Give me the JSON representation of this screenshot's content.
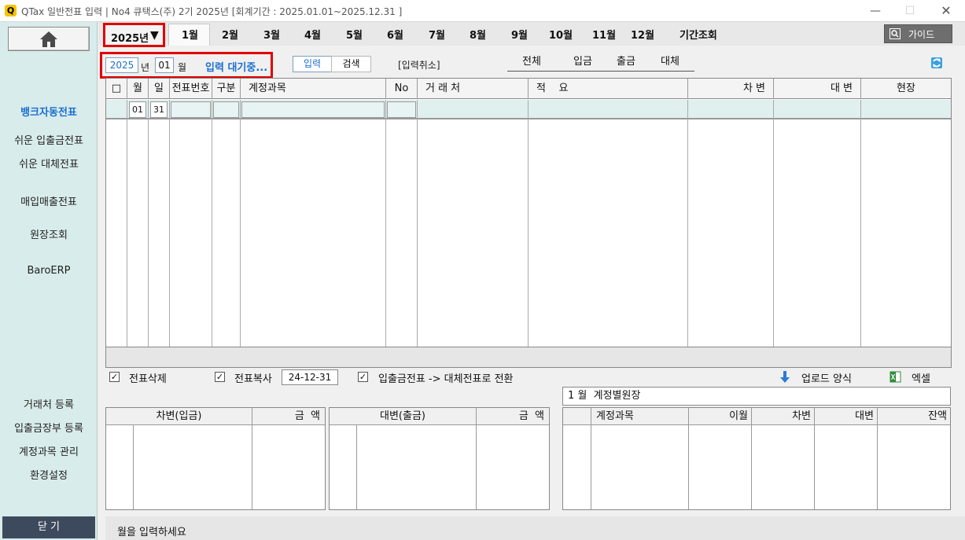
{
  "window": {
    "app_icon_letter": "Q",
    "title": "QTax 일반전표 입력 | No4 큐택스(주) 2기 2025년 [회계기간 : 2025.01.01~2025.12.31 ]",
    "minimize": "—",
    "maximize": "☐",
    "close": "✕"
  },
  "sidebar": {
    "home_icon": "home-icon",
    "items": [
      "뱅크자동전표",
      "쉬운 입출금전표",
      "쉬운 대체전표",
      "매입매출전표",
      "원장조회",
      "BaroERP",
      "거래처 등록",
      "입출금장부 등록",
      "계정과목 관리",
      "환경설정"
    ],
    "close_label": "닫 기"
  },
  "topbar": {
    "year_selector": "2025년",
    "year_arrow": "▼",
    "months": [
      "1월",
      "2월",
      "3월",
      "4월",
      "5월",
      "6월",
      "7월",
      "8월",
      "9월",
      "10월",
      "11월",
      "12월"
    ],
    "period_query": "기간조회",
    "guide_label": "가이드",
    "guide_icon": "search-icon"
  },
  "entry": {
    "year_value": "2025",
    "year_unit": "년",
    "month_value": "01",
    "month_unit": "월",
    "status_text": "입력 대기중...",
    "mode_input": "입력",
    "mode_search": "검색",
    "cancel_input": "[입력취소]",
    "filters": [
      "전체",
      "입금",
      "출금",
      "대체"
    ],
    "refresh_icon": "refresh-icon"
  },
  "grid": {
    "columns": [
      "□",
      "월",
      "일",
      "전표번호",
      "구분",
      "계정과목",
      "No",
      "거 래 처",
      "적    요",
      "차 변",
      "대 변",
      "현장"
    ],
    "first_row": {
      "month": "01",
      "day": "31"
    }
  },
  "options": {
    "delete_voucher": "전표삭제",
    "copy_voucher": "전표복사",
    "copy_date": "24-12-31",
    "convert": "입출금전표 -> 대체전표로 전환",
    "check_mark": "✓",
    "upload_label": "업로드 양식",
    "upload_icon": "download-arrow-icon",
    "excel_label": "엑셀",
    "excel_icon": "excel-icon"
  },
  "debit_panel": {
    "col1": "차변(입금)",
    "col2": "금  액"
  },
  "credit_panel": {
    "col1": "대변(출금)",
    "col2": "금  액"
  },
  "ledger_panel": {
    "title": "1 월  계정별원장",
    "columns": [
      "계정과목",
      "이월",
      "차변",
      "대변",
      "잔액"
    ]
  },
  "status_bar": {
    "message": "월을 입력하세요"
  },
  "colors": {
    "accent_blue": "#1b6fd1",
    "highlight_red": "#e00000",
    "sidebar_bg": "#d8eceb",
    "row_highlight": "#dff0ef",
    "close_bg": "#3d4a5e"
  }
}
